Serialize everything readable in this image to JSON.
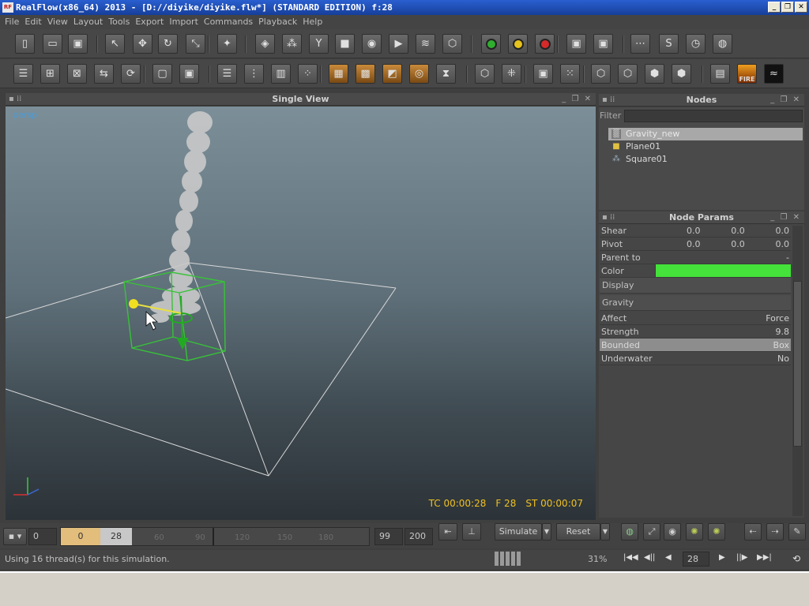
{
  "window": {
    "title": "RealFlow(x86_64) 2013 - [D://diyike/diyike.flw*] (STANDARD EDITION) f:28",
    "logo_text": "RF"
  },
  "menu": [
    "File",
    "Edit",
    "View",
    "Layout",
    "Tools",
    "Export",
    "Import",
    "Commands",
    "Playback",
    "Help"
  ],
  "toolbar_row1": [
    {
      "name": "new-scene-icon",
      "glyph": "▯"
    },
    {
      "name": "open-folder-icon",
      "glyph": "▭"
    },
    {
      "name": "save-icon",
      "glyph": "▣"
    },
    {
      "name": "select-arrow-icon",
      "glyph": "↖"
    },
    {
      "name": "move-icon",
      "glyph": "✥"
    },
    {
      "name": "rotate-icon",
      "glyph": "↻"
    },
    {
      "name": "scale-icon",
      "glyph": "⤡"
    },
    {
      "name": "axis-icon",
      "glyph": "✦"
    },
    {
      "name": "emitter-icon",
      "glyph": "◈"
    },
    {
      "name": "particles-icon",
      "glyph": "⁂"
    },
    {
      "name": "daemon-icon",
      "glyph": "Y"
    },
    {
      "name": "object-cube-icon",
      "glyph": "■"
    },
    {
      "name": "mesh-icon",
      "glyph": "◉"
    },
    {
      "name": "camera-icon",
      "glyph": "▶"
    },
    {
      "name": "wave-icon",
      "glyph": "≋"
    },
    {
      "name": "rigid-body-icon",
      "glyph": "⬡"
    },
    {
      "name": "green-circle-icon",
      "color": "#2fae2f"
    },
    {
      "name": "yellow-circle-icon",
      "color": "#e6c21c"
    },
    {
      "name": "red-circle-icon",
      "color": "#d42a2a"
    },
    {
      "name": "export-save-icon",
      "glyph": "▣"
    },
    {
      "name": "export-red-icon",
      "glyph": "▣"
    },
    {
      "name": "script-graph-icon",
      "glyph": "⋯"
    },
    {
      "name": "script-curve-icon",
      "glyph": "S"
    },
    {
      "name": "script-timer-icon",
      "glyph": "◷"
    },
    {
      "name": "script-world-icon",
      "glyph": "◍"
    }
  ],
  "toolbar_row2": [
    "node-list-icon",
    "add-node-icon",
    "remove-node-icon",
    "link-node-icon",
    "cycle-node-icon",
    "box-transparent-icon",
    "box-solid-icon",
    "script-list-icon",
    "dna-icon",
    "ruler-icon",
    "grid-dots-icon",
    "mesh-box-icon",
    "mesh-grid-icon",
    "mesh-split-icon",
    "mesh-target-icon",
    "hourglass-icon",
    "wire-box-icon",
    "wire-dots-icon",
    "bbox-icon",
    "scatter-icon",
    "shade-wire-icon",
    "shade-flat-icon",
    "shade-smooth-icon",
    "shade-solid-icon",
    "render-icon",
    "fire-icon",
    "ocean-icon"
  ],
  "toolbar_row2_labels": {
    "fire": "FIRE"
  },
  "viewport": {
    "title": "Single View",
    "camera": "persp",
    "timecode": "TC 00:00:28",
    "frame": "F 28",
    "sim_time": "ST 00:00:07"
  },
  "nodes": {
    "title": "Nodes",
    "filter_label": "Filter",
    "filter_value": "",
    "items": [
      {
        "label": "Gravity_new",
        "icon": "gravity-icon",
        "glyph": "▒",
        "selected": true
      },
      {
        "label": "Plane01",
        "icon": "plane-object-icon",
        "glyph": "■",
        "selected": false
      },
      {
        "label": "Square01",
        "icon": "emitter-square-icon",
        "glyph": "⁂",
        "selected": false
      }
    ]
  },
  "params": {
    "title": "Node Params",
    "shear": {
      "label": "Shear",
      "values": [
        "0.0",
        "0.0",
        "0.0"
      ]
    },
    "pivot": {
      "label": "Pivot",
      "values": [
        "0.0",
        "0.0",
        "0.0"
      ]
    },
    "parent_to": {
      "label": "Parent to",
      "value": "-"
    },
    "color": {
      "label": "Color",
      "value": "#44e23a"
    },
    "sections": [
      "Display",
      "Gravity"
    ],
    "rows": [
      {
        "label": "Affect",
        "value": "Force",
        "highlight": false
      },
      {
        "label": "Strength",
        "value": "9.8",
        "highlight": false
      },
      {
        "label": "Bounded",
        "value": "Box",
        "highlight": true
      },
      {
        "label": "Underwater",
        "value": "No",
        "highlight": false
      }
    ]
  },
  "timeline": {
    "start": "0",
    "current_start": "0",
    "current": "28",
    "ticks": [
      "60",
      "90",
      "120",
      "150",
      "180"
    ],
    "end_visible": "99",
    "end": "200",
    "simulate_label": "Simulate",
    "reset_label": "Reset"
  },
  "status": {
    "message": "Using 16 thread(s) for this simulation.",
    "percent": "31%",
    "frame": "28"
  }
}
